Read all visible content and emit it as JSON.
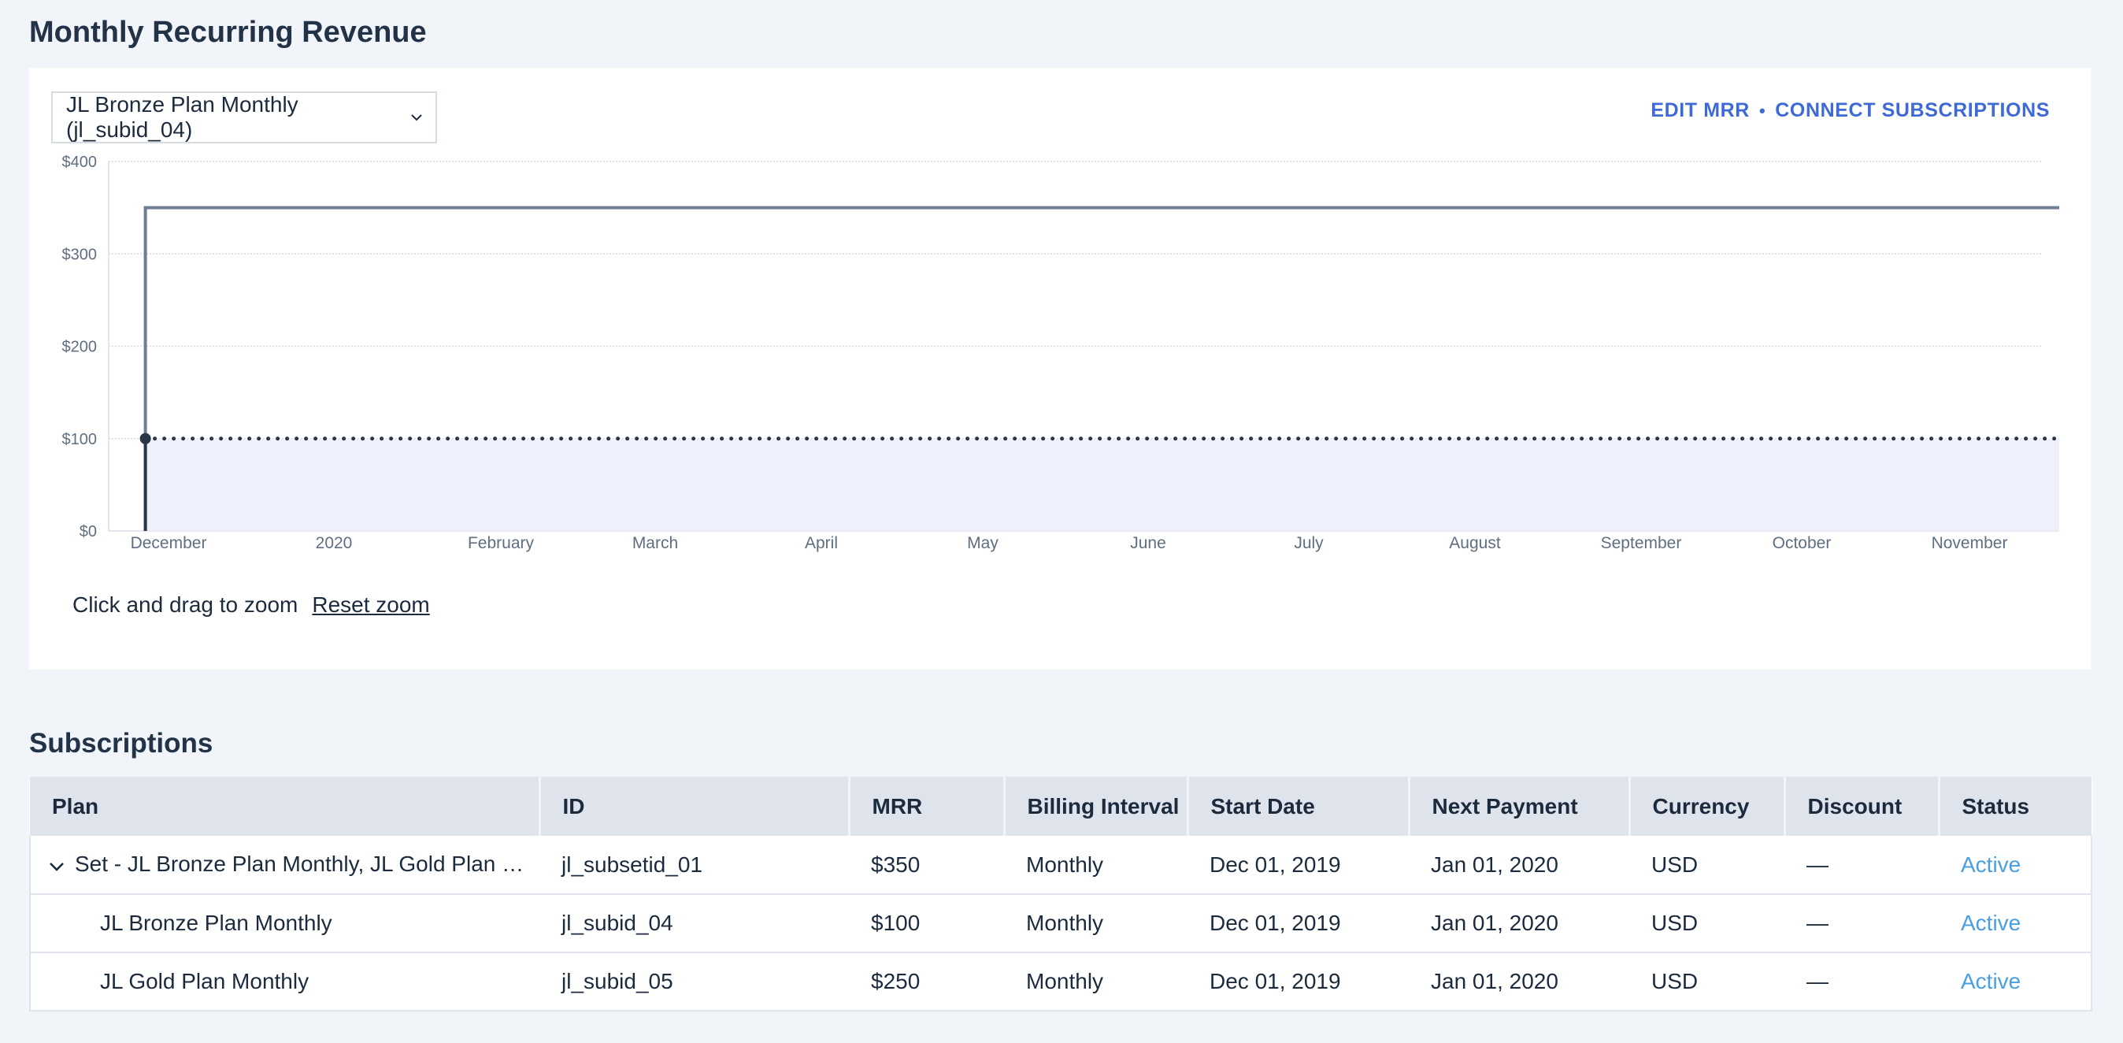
{
  "page_title": "Monthly Recurring Revenue",
  "plan_select": {
    "value": "JL Bronze Plan Monthly (jl_subid_04)"
  },
  "actions": {
    "edit": "EDIT MRR",
    "separator": "•",
    "connect": "CONNECT SUBSCRIPTIONS"
  },
  "zoom": {
    "hint": "Click and drag to zoom",
    "reset": "Reset zoom"
  },
  "chart_data": {
    "type": "line",
    "y_ticks": [
      "$0",
      "$100",
      "$200",
      "$300",
      "$400"
    ],
    "ylim": [
      0,
      400
    ],
    "x_labels": [
      "December",
      "2020",
      "February",
      "March",
      "April",
      "May",
      "June",
      "July",
      "August",
      "September",
      "October",
      "November"
    ],
    "xlim": [
      "2019-11-24",
      "2020-11-30"
    ],
    "grid": true,
    "colors": {
      "total": "#6e7d91",
      "selected": "#2a3545",
      "fill": "#eef1fb",
      "grid": "#d5dae2"
    },
    "series": [
      {
        "x": [
          "2019-12-01",
          "2020-11-30"
        ],
        "values": [
          350,
          350
        ],
        "style": "solid"
      },
      {
        "x": [
          "2019-12-01",
          "2020-11-30"
        ],
        "values": [
          100,
          100
        ],
        "style": "dotted",
        "fill": true
      }
    ]
  },
  "subscriptions": {
    "title": "Subscriptions",
    "columns": [
      "Plan",
      "ID",
      "MRR",
      "Billing Interval",
      "Start Date",
      "Next Payment",
      "Currency",
      "Discount",
      "Status"
    ],
    "rows": [
      {
        "plan": "Set - JL Bronze Plan Monthly, JL Gold Plan M…",
        "id": "jl_subsetid_01",
        "mrr": "$350",
        "interval": "Monthly",
        "start": "Dec 01, 2019",
        "next": "Jan 01, 2020",
        "currency": "USD",
        "discount": "—",
        "status": "Active"
      },
      {
        "plan": "JL Bronze Plan Monthly",
        "id": "jl_subid_04",
        "mrr": "$100",
        "interval": "Monthly",
        "start": "Dec 01, 2019",
        "next": "Jan 01, 2020",
        "currency": "USD",
        "discount": "—",
        "status": "Active"
      },
      {
        "plan": "JL Gold Plan Monthly",
        "id": "jl_subid_05",
        "mrr": "$250",
        "interval": "Monthly",
        "start": "Dec 01, 2019",
        "next": "Jan 01, 2020",
        "currency": "USD",
        "discount": "—",
        "status": "Active"
      }
    ]
  }
}
